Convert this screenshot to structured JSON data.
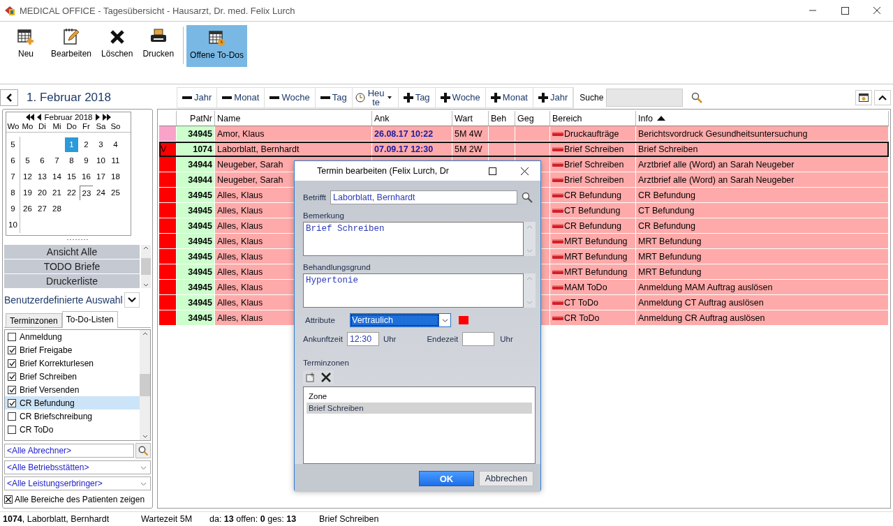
{
  "window": {
    "title": "MEDICAL OFFICE - Tagesübersicht - Hausarzt, Dr. med. Felix Lurch"
  },
  "toolbar": [
    {
      "kind": "new",
      "label": "Neu",
      "selected": false
    },
    {
      "kind": "edit",
      "label": "Bearbeiten",
      "selected": false
    },
    {
      "kind": "delete",
      "label": "Löschen",
      "selected": false
    },
    {
      "kind": "print",
      "label": "Drucken",
      "selected": false
    },
    {
      "kind": "todos",
      "label": "Offene To-Dos",
      "selected": true
    }
  ],
  "date_nav": {
    "date": "1. Februar 2018",
    "steps": [
      {
        "kind": "minus",
        "label": "Jahr"
      },
      {
        "kind": "minus",
        "label": "Monat"
      },
      {
        "kind": "minus",
        "label": "Woche"
      },
      {
        "kind": "minus",
        "label": "Tag"
      },
      {
        "kind": "today",
        "label": "Heute"
      },
      {
        "kind": "plus",
        "label": "Tag"
      },
      {
        "kind": "plus",
        "label": "Woche"
      },
      {
        "kind": "plus",
        "label": "Monat"
      },
      {
        "kind": "plus",
        "label": "Jahr"
      }
    ],
    "search_label": "Suche"
  },
  "calendar": {
    "month": "Februar 2018",
    "week_header": "Wo",
    "weekdays": [
      "Mo",
      "Di",
      "Mi",
      "Do",
      "Fr",
      "Sa",
      "So"
    ],
    "weeks": [
      {
        "week": "5",
        "days": [
          {
            "label": "1",
            "selected": true,
            "today": false
          },
          {
            "label": "2",
            "selected": false,
            "today": false
          },
          {
            "label": "3",
            "selected": false,
            "today": false
          },
          {
            "label": "4",
            "selected": false,
            "today": false
          }
        ]
      },
      {
        "week": "6",
        "days": [
          {
            "label": "5",
            "selected": false,
            "today": false
          },
          {
            "label": "6",
            "selected": false,
            "today": false
          },
          {
            "label": "7",
            "selected": false,
            "today": false
          },
          {
            "label": "8",
            "selected": false,
            "today": false
          },
          {
            "label": "9",
            "selected": false,
            "today": false
          },
          {
            "label": "10",
            "selected": false,
            "today": false
          },
          {
            "label": "11",
            "selected": false,
            "today": false
          }
        ]
      },
      {
        "week": "7",
        "days": [
          {
            "label": "12",
            "selected": false,
            "today": false
          },
          {
            "label": "13",
            "selected": false,
            "today": false
          },
          {
            "label": "14",
            "selected": false,
            "today": false
          },
          {
            "label": "15",
            "selected": false,
            "today": false
          },
          {
            "label": "16",
            "selected": false,
            "today": false
          },
          {
            "label": "17",
            "selected": false,
            "today": false
          },
          {
            "label": "18",
            "selected": false,
            "today": false
          }
        ]
      },
      {
        "week": "8",
        "days": [
          {
            "label": "19",
            "selected": false,
            "today": false
          },
          {
            "label": "20",
            "selected": false,
            "today": false
          },
          {
            "label": "21",
            "selected": false,
            "today": false
          },
          {
            "label": "22",
            "selected": false,
            "today": false
          },
          {
            "label": "23",
            "selected": false,
            "today": true
          },
          {
            "label": "24",
            "selected": false,
            "today": false
          },
          {
            "label": "25",
            "selected": false,
            "today": false
          }
        ]
      },
      {
        "week": "9",
        "days": [
          {
            "label": "26",
            "selected": false,
            "today": false
          },
          {
            "label": "27",
            "selected": false,
            "today": false
          },
          {
            "label": "28",
            "selected": false,
            "today": false
          }
        ]
      },
      {
        "week": "10"
      }
    ]
  },
  "views": [
    "Ansicht Alle",
    "TODO Briefe",
    "Druckerliste"
  ],
  "view_select": "Benutzerdefinierte Auswahl",
  "side_tabs": [
    {
      "label": "Terminzonen",
      "selected": false
    },
    {
      "label": "To-Do-Listen",
      "selected": true
    }
  ],
  "todo_lists": [
    {
      "label": "Anmeldung",
      "checked": false,
      "selected": false
    },
    {
      "label": "Brief Freigabe",
      "checked": true,
      "selected": false
    },
    {
      "label": "Brief Korrekturlesen",
      "checked": true,
      "selected": false
    },
    {
      "label": "Brief Schreiben",
      "checked": true,
      "selected": false
    },
    {
      "label": "Brief Versenden",
      "checked": true,
      "selected": false
    },
    {
      "label": "CR Befundung",
      "checked": true,
      "selected": true
    },
    {
      "label": "CR Briefschreibung",
      "checked": false,
      "selected": false
    },
    {
      "label": "CR ToDo",
      "checked": false,
      "selected": false
    }
  ],
  "filters": {
    "abrechner": "<Alle Abrechner>",
    "betriebsstaetten": "<Alle Betriebsstätten>",
    "leistungserbringer": "<Alle Leistungserbringer>"
  },
  "all_areas": {
    "label": "Alle Bereiche des Patienten zeigen",
    "checked": true
  },
  "table": {
    "columns": [
      {
        "label": "PatNr",
        "sorted": false
      },
      {
        "label": "Name",
        "sorted": false
      },
      {
        "label": "Ank",
        "sorted": false
      },
      {
        "label": "Wart",
        "sorted": false
      },
      {
        "label": "Beh",
        "sorted": false
      },
      {
        "label": "Geg",
        "sorted": false
      },
      {
        "label": "Bereich",
        "sorted": false
      },
      {
        "label": "Info",
        "sorted": true
      }
    ],
    "rows": [
      {
        "color": "#f9a3c9",
        "selected": false,
        "patnr": "34945",
        "name": "Amor, Klaus",
        "ank": "26.08.17  10:22",
        "wart": "5M 4W",
        "bereich": "Druckaufträge",
        "info": "Berichtsvordruck Gesundheitsuntersuchung"
      },
      {
        "color": "#ff0000",
        "marker": "V",
        "selected": true,
        "patnr": "1074",
        "name": "Laborblatt, Bernhardt",
        "ank": "07.09.17  12:30",
        "wart": "5M 2W",
        "bereich": "Brief Schreiben",
        "info": "Brief Schreiben"
      },
      {
        "color": "#ff0000",
        "selected": false,
        "patnr": "34944",
        "name": "Neugeber, Sarah",
        "bereich": "Brief Schreiben",
        "info": "Arztbrief alle (Word) an Sarah Neugeber"
      },
      {
        "color": "#ff0000",
        "selected": false,
        "patnr": "34944",
        "name": "Neugeber, Sarah",
        "bereich": "Brief Schreiben",
        "info": "Arztbrief alle (Word) an Sarah Neugeber"
      },
      {
        "color": "#ff0000",
        "selected": false,
        "patnr": "34945",
        "name": "Alles, Klaus",
        "bereich": "CR Befundung",
        "info": "CR Befundung"
      },
      {
        "color": "#ff0000",
        "selected": false,
        "patnr": "34945",
        "name": "Alles, Klaus",
        "bereich": "CT Befundung",
        "info": "CT Befundung"
      },
      {
        "color": "#ff0000",
        "selected": false,
        "patnr": "34945",
        "name": "Alles, Klaus",
        "bereich": "CR Befundung",
        "info": "CR Befundung"
      },
      {
        "color": "#ff0000",
        "selected": false,
        "patnr": "34945",
        "name": "Alles, Klaus",
        "bereich": "MRT Befundung",
        "info": "MRT Befundung"
      },
      {
        "color": "#ff0000",
        "selected": false,
        "patnr": "34945",
        "name": "Alles, Klaus",
        "bereich": "MRT Befundung",
        "info": "MRT Befundung"
      },
      {
        "color": "#ff0000",
        "selected": false,
        "patnr": "34945",
        "name": "Alles, Klaus",
        "bereich": "MRT Befundung",
        "info": "MRT Befundung"
      },
      {
        "color": "#ff0000",
        "selected": false,
        "patnr": "34945",
        "name": "Alles, Klaus",
        "bereich": "MAM ToDo",
        "info": "Anmeldung MAM Auftrag auslösen"
      },
      {
        "color": "#ff0000",
        "selected": false,
        "patnr": "34945",
        "name": "Alles, Klaus",
        "bereich": "CT ToDo",
        "info": "Anmeldung CT Auftrag auslösen"
      },
      {
        "color": "#ff0000",
        "selected": false,
        "patnr": "34945",
        "name": "Alles, Klaus",
        "bereich": "CR ToDo",
        "info": "Anmeldung CR Auftrag auslösen"
      }
    ]
  },
  "dialog": {
    "title": "Termin bearbeiten (Felix Lurch, Dr",
    "betrifft_label": "Betrifft",
    "betrifft": "Laborblatt, Bernhardt",
    "bemerkung_label": "Bemerkung",
    "bemerkung": "Brief Schreiben",
    "grund_label": "Behandlungsgrund",
    "grund": "Hypertonie",
    "attribute_label": "Attribute",
    "attribute": "Vertraulich",
    "ankunft_label": "Ankunftzeit",
    "ankunft": "12:30",
    "ankunft_unit": "Uhr",
    "ende_label": "Endezeit",
    "ende_unit": "Uhr",
    "zonen_label": "Terminzonen",
    "zone_header": "Zone",
    "zones": [
      {
        "label": "Brief Schreiben",
        "selected": true
      }
    ],
    "ok": "OK",
    "cancel": "Abbrechen"
  },
  "status_bar": {
    "patient": "**1074**, Laborblatt, Bernhardt",
    "wait": "Wartezeit 5M",
    "counts": "da: **13** offen: **0** ges: **13**",
    "area": "Brief Schreiben"
  }
}
